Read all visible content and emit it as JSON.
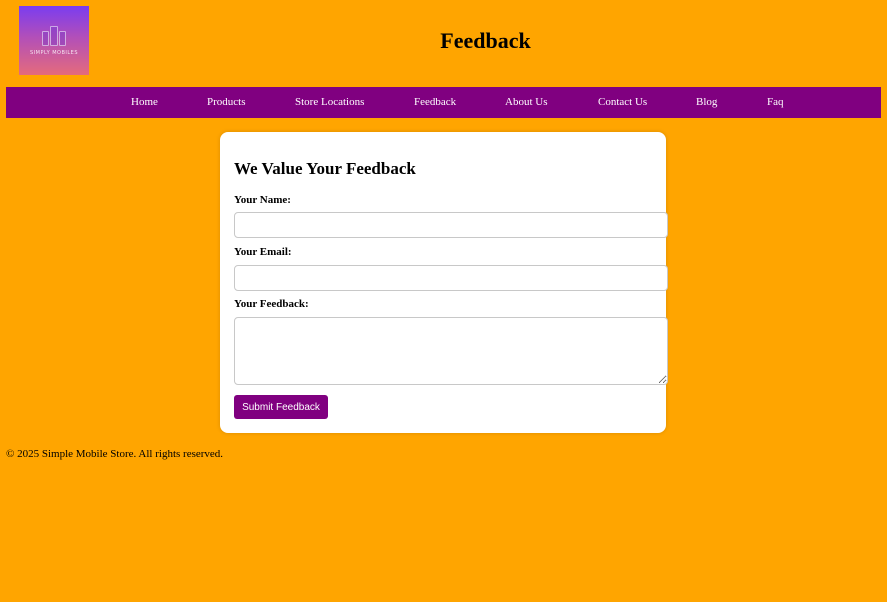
{
  "header": {
    "logo_text": "SIMPLY MOBILES",
    "title": "Feedback"
  },
  "nav": {
    "items": [
      {
        "label": "Home"
      },
      {
        "label": "Products"
      },
      {
        "label": "Store Locations"
      },
      {
        "label": "Feedback"
      },
      {
        "label": "About Us"
      },
      {
        "label": "Contact Us"
      },
      {
        "label": "Blog"
      },
      {
        "label": "Faq"
      }
    ]
  },
  "form": {
    "heading": "We Value Your Feedback",
    "name_label": "Your Name:",
    "name_value": "",
    "email_label": "Your Email:",
    "email_value": "",
    "feedback_label": "Your Feedback:",
    "feedback_value": "",
    "submit_label": "Submit Feedback"
  },
  "footer": {
    "text": "© 2025 Simple Mobile Store. All rights reserved."
  },
  "colors": {
    "background": "#ffa500",
    "nav_background": "#800080",
    "button_background": "#800080",
    "card_background": "#ffffff"
  }
}
